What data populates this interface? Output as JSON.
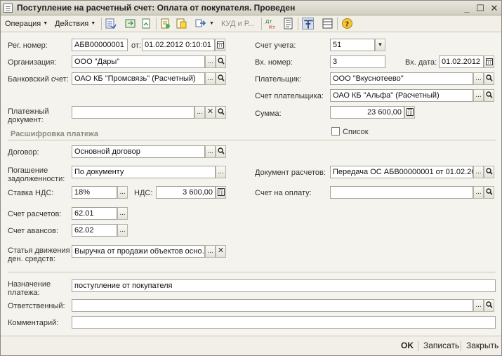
{
  "window": {
    "title": "Поступление на расчетный счет: Оплата от покупателя. Проведен",
    "controls": {
      "minimize": "_",
      "maximize": "☐",
      "close": "✕"
    }
  },
  "toolbar": {
    "operation": "Операция",
    "actions": "Действия",
    "kud": "КУД и Р..."
  },
  "form": {
    "reg_number_label": "Рег. номер:",
    "reg_number": "АБВ00000001",
    "date_from_label": "от:",
    "date": "01.02.2012  0:10:01",
    "organization_label": "Организация:",
    "organization": "ООО \"Дары\"",
    "bank_account_label": "Банковский счет:",
    "bank_account": "ОАО КБ \"Промсвязь\" (Расчетный)",
    "payment_doc_label": "Платежный документ:",
    "payment_doc": "",
    "account_label": "Счет учета:",
    "account": "51",
    "incoming_number_label": "Вх. номер:",
    "incoming_number": "3",
    "incoming_date_label": "Вх. дата:",
    "incoming_date": "01.02.2012",
    "payer_label": "Плательщик:",
    "payer": "ООО \"Вкуснотеево\"",
    "payer_account_label": "Счет плательщика:",
    "payer_account": "ОАО КБ \"Альфа\" (Расчетный)",
    "sum_label": "Сумма:",
    "sum": "23 600,00",
    "list_checkbox_label": "Список"
  },
  "details": {
    "section_title": "Расшифровка платежа",
    "contract_label": "Договор:",
    "contract": "Основной договор",
    "debt_repayment_label": "Погашение задолженности:",
    "debt_repayment": "По документу",
    "vat_rate_label": "Ставка НДС:",
    "vat_rate": "18%",
    "vat_label": "НДС:",
    "vat": "3 600,00",
    "settlement_doc_label": "Документ расчетов:",
    "settlement_doc": "Передача ОС АБВ00000001 от 01.02.20…",
    "invoice_label": "Счет на оплату:",
    "invoice": "",
    "settlement_account_label": "Счет расчетов:",
    "settlement_account": "62.01",
    "advance_account_label": "Счет авансов:",
    "advance_account": "62.02",
    "cash_flow_label": "Статья движения ден. средств:",
    "cash_flow": "Выручка от продажи объектов осно…"
  },
  "footer_fields": {
    "purpose_label": "Назначение платежа:",
    "purpose": "поступление от покупателя",
    "responsible_label": "Ответственный:",
    "responsible": "",
    "comment_label": "Комментарий:",
    "comment": ""
  },
  "bottom_buttons": {
    "ok": "OK",
    "save": "Записать",
    "close": "Закрыть"
  }
}
